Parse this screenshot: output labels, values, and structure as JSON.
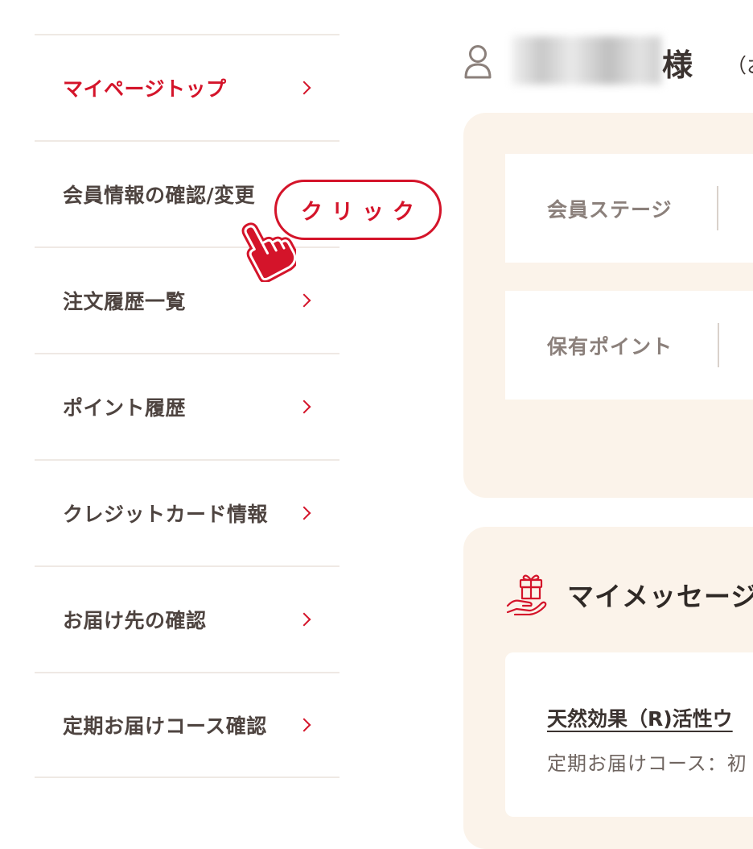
{
  "sidebar": {
    "items": [
      {
        "label": "マイページトップ",
        "active": true
      },
      {
        "label": "会員情報の確認/変更",
        "active": false
      },
      {
        "label": "注文履歴一覧",
        "active": false
      },
      {
        "label": "ポイント履歴",
        "active": false
      },
      {
        "label": "クレジットカード情報",
        "active": false
      },
      {
        "label": "お届け先の確認",
        "active": false
      },
      {
        "label": "定期お届けコース確認",
        "active": false
      }
    ]
  },
  "callout": {
    "label": "クリック"
  },
  "header": {
    "honorific": "様",
    "extra": "（お"
  },
  "member": {
    "stage_label": "会員ステージ",
    "points_label": "保有ポイント"
  },
  "messages": {
    "title": "マイメッセージ",
    "link_text": "天然効果（R)活性ウ",
    "subtext": "定期お届けコース：初"
  },
  "colors": {
    "accent": "#d4142a",
    "panel_bg": "#fbf3ea",
    "text": "#4e4440"
  }
}
